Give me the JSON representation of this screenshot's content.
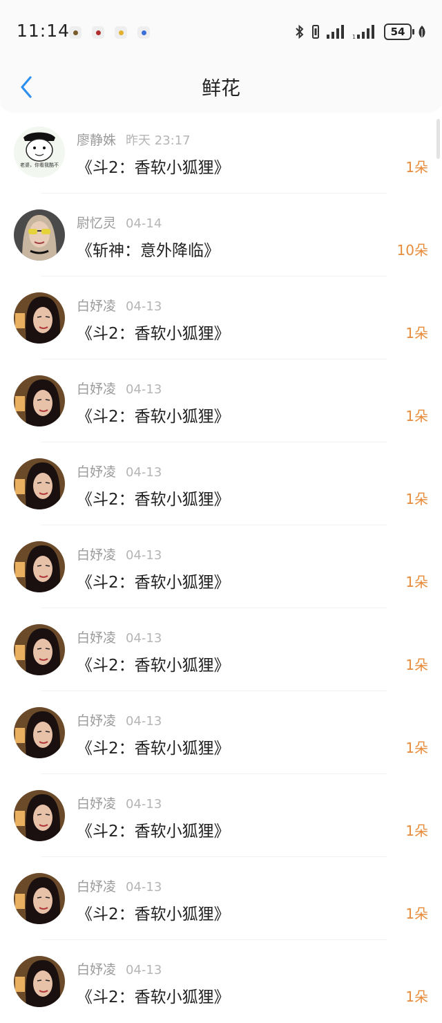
{
  "status_bar": {
    "time": "11:14",
    "battery": "54"
  },
  "header": {
    "title": "鲜花"
  },
  "avatar_caption": "老婆，你看我酷不",
  "items": [
    {
      "name": "廖静姝",
      "date": "昨天 23:17",
      "book": "《斗2：香软小狐狸》",
      "count": "1朵"
    },
    {
      "name": "尉忆灵",
      "date": "04-14",
      "book": "《斩神：意外降临》",
      "count": "10朵"
    },
    {
      "name": "白妤凌",
      "date": "04-13",
      "book": "《斗2：香软小狐狸》",
      "count": "1朵"
    },
    {
      "name": "白妤凌",
      "date": "04-13",
      "book": "《斗2：香软小狐狸》",
      "count": "1朵"
    },
    {
      "name": "白妤凌",
      "date": "04-13",
      "book": "《斗2：香软小狐狸》",
      "count": "1朵"
    },
    {
      "name": "白妤凌",
      "date": "04-13",
      "book": "《斗2：香软小狐狸》",
      "count": "1朵"
    },
    {
      "name": "白妤凌",
      "date": "04-13",
      "book": "《斗2：香软小狐狸》",
      "count": "1朵"
    },
    {
      "name": "白妤凌",
      "date": "04-13",
      "book": "《斗2：香软小狐狸》",
      "count": "1朵"
    },
    {
      "name": "白妤凌",
      "date": "04-13",
      "book": "《斗2：香软小狐狸》",
      "count": "1朵"
    },
    {
      "name": "白妤凌",
      "date": "04-13",
      "book": "《斗2：香软小狐狸》",
      "count": "1朵"
    },
    {
      "name": "白妤凌",
      "date": "04-13",
      "book": "《斗2：香软小狐狸》",
      "count": "1朵"
    }
  ],
  "colors": {
    "accent": "#2f8ff0",
    "count": "#e88b3a"
  }
}
